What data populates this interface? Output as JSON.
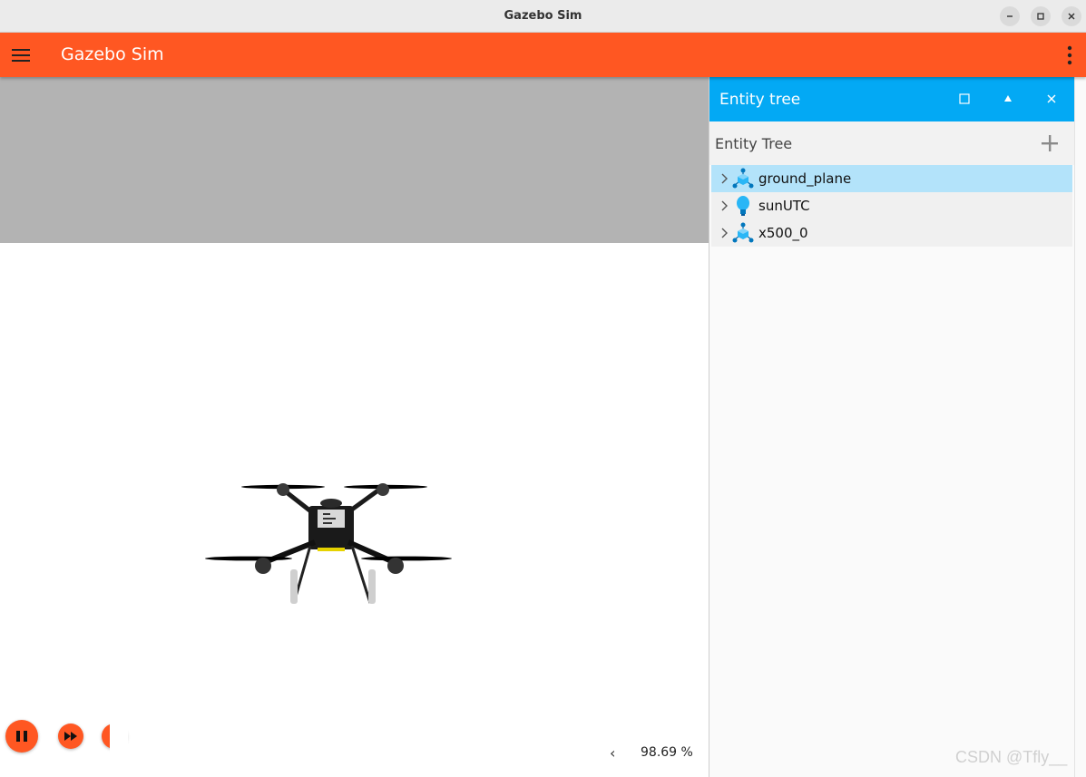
{
  "window": {
    "title": "Gazebo Sim"
  },
  "appbar": {
    "title": "Gazebo Sim"
  },
  "colors": {
    "accent": "#ff5722",
    "panel_header": "#03a9f4",
    "selected_row": "#b3e3fa",
    "sky": "#b3b3b3"
  },
  "entity_tree_panel": {
    "header_title": "Entity tree",
    "toolbar_title": "Entity Tree",
    "items": [
      {
        "label": "ground_plane",
        "icon": "model-icon",
        "selected": true
      },
      {
        "label": "sunUTC",
        "icon": "light-bulb-icon",
        "selected": false
      },
      {
        "label": "x500_0",
        "icon": "model-icon",
        "selected": false
      }
    ]
  },
  "world_control": {
    "play_state_icon": "pause-icon",
    "step_icon": "fast-forward-icon"
  },
  "stats": {
    "real_time_factor": "98.69 %"
  },
  "watermark": "CSDN @Tfly__"
}
